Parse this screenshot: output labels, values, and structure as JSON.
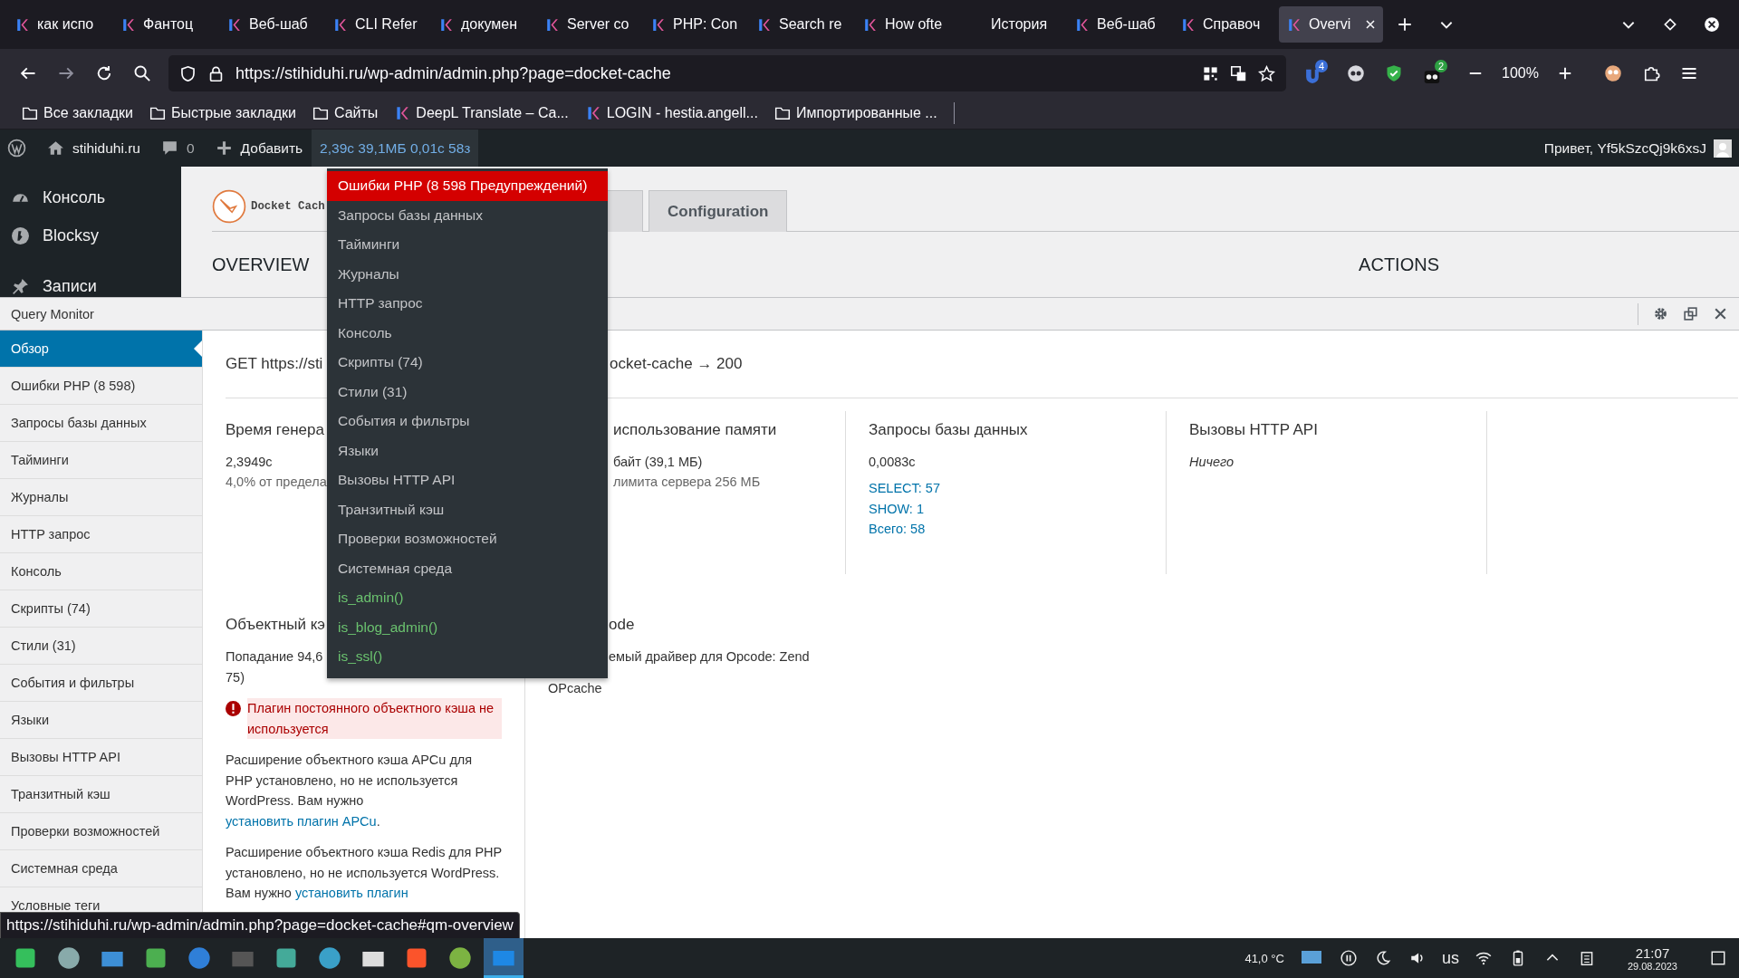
{
  "browser": {
    "tabs": [
      {
        "title": "как испо",
        "has_icon": true,
        "selected": false
      },
      {
        "title": "Фантоц",
        "has_icon": true,
        "selected": false
      },
      {
        "title": "Веб-шаб",
        "has_icon": true,
        "selected": false
      },
      {
        "title": "CLI Refer",
        "has_icon": true,
        "selected": false
      },
      {
        "title": "докумен",
        "has_icon": true,
        "selected": false
      },
      {
        "title": "Server co",
        "has_icon": true,
        "selected": false
      },
      {
        "title": "PHP: Con",
        "has_icon": true,
        "selected": false
      },
      {
        "title": "Search re",
        "has_icon": true,
        "selected": false
      },
      {
        "title": "How ofte",
        "has_icon": true,
        "selected": false
      },
      {
        "title": "История",
        "has_icon": false,
        "selected": false
      },
      {
        "title": "Веб-шаб",
        "has_icon": true,
        "selected": false
      },
      {
        "title": "Справоч",
        "has_icon": true,
        "selected": false
      },
      {
        "title": "Overvi",
        "has_icon": true,
        "selected": true
      }
    ],
    "url": "https://stihiduhi.ru/wp-admin/admin.php?page=docket-cache",
    "extension_badges": [
      "4",
      "2"
    ],
    "zoom": "100%",
    "bookmarks": [
      {
        "label": "Все закладки",
        "kind": "folder"
      },
      {
        "label": "Быстрые закладки",
        "kind": "folder"
      },
      {
        "label": "Сайты",
        "kind": "folder"
      },
      {
        "label": "DeepL Translate – Ca...",
        "kind": "site"
      },
      {
        "label": "LOGIN - hestia.angell...",
        "kind": "site"
      },
      {
        "label": "Импортированные ...",
        "kind": "folder"
      }
    ]
  },
  "admin_bar": {
    "site": "stihiduhi.ru",
    "comments": "0",
    "new": "Добавить",
    "qm_stats": "2,39с 39,1МБ 0,01с 58з",
    "greeting": "Привет, Yf5kSzcQj9k6xsJ"
  },
  "wp_menu": [
    "Консоль",
    "Blocksy",
    "Записи"
  ],
  "plugin": {
    "name": "Docket Cach",
    "tabs": [
      {
        "label": "Configuration",
        "selected": false
      }
    ],
    "sections": [
      "OVERVIEW",
      "ACTIONS"
    ]
  },
  "query_monitor": {
    "title": "Query Monitor",
    "nav": [
      {
        "label": "Обзор",
        "selected": true
      },
      {
        "label": "Ошибки PHP (8 598)",
        "selected": false
      },
      {
        "label": "Запросы базы данных",
        "selected": false
      },
      {
        "label": "Тайминги",
        "selected": false
      },
      {
        "label": "Журналы",
        "selected": false
      },
      {
        "label": "HTTP запрос",
        "selected": false
      },
      {
        "label": "Консоль",
        "selected": false
      },
      {
        "label": "Скрипты (74)",
        "selected": false
      },
      {
        "label": "Стили (31)",
        "selected": false
      },
      {
        "label": "События и фильтры",
        "selected": false
      },
      {
        "label": "Языки",
        "selected": false
      },
      {
        "label": "Вызовы HTTP API",
        "selected": false
      },
      {
        "label": "Транзитный кэш",
        "selected": false
      },
      {
        "label": "Проверки возможностей",
        "selected": false
      },
      {
        "label": "Системная среда",
        "selected": false
      },
      {
        "label": "Условные теги",
        "selected": false
      }
    ],
    "request": [
      "GET https://sti",
      "ocket-cache → 200"
    ],
    "overview": [
      {
        "title": "Время генера",
        "value": "2,3949с",
        "note": "4,0% от предела"
      },
      {
        "title": "использование памяти",
        "value": "байт (39,1 МБ)",
        "note": "лимита сервера 256 МБ"
      },
      {
        "title": "Запросы базы данных",
        "value": "0,0083с",
        "links": [
          "SELECT: 57",
          "SHOW: 1",
          "Всего: 58"
        ]
      },
      {
        "title": "Вызовы HTTP API",
        "empty": "Ничего"
      }
    ],
    "object_cache": {
      "title": "Объектный кэ",
      "hit": [
        "Попадание 94,6",
        "75)"
      ],
      "warning": "Плагин постоянного объектного кэша не используется",
      "paragraphs": [
        {
          "text": "Расширение объектного кэша APCu для PHP установлено, но не используется WordPress. Вам нужно ",
          "link": "установить плагин APCu",
          "after": "."
        },
        {
          "text": "Расширение объектного кэша Redis для PHP установлено, но не используется WordPress. Вам нужно ",
          "link": "установить плагин"
        }
      ]
    },
    "opcode": {
      "title": "ode",
      "driver": "емый драйвер для Opcode: Zend",
      "name": "OPcache"
    }
  },
  "dropdown": [
    {
      "label": "Ошибки PHP (8 598 Предупреждений)",
      "kind": "error"
    },
    {
      "label": "Запросы базы данных",
      "kind": "item"
    },
    {
      "label": "Тайминги",
      "kind": "item"
    },
    {
      "label": "Журналы",
      "kind": "item"
    },
    {
      "label": "HTTP запрос",
      "kind": "item"
    },
    {
      "label": "Консоль",
      "kind": "item"
    },
    {
      "label": "Скрипты (74)",
      "kind": "item"
    },
    {
      "label": "Стили (31)",
      "kind": "item"
    },
    {
      "label": "События и фильтры",
      "kind": "item"
    },
    {
      "label": "Языки",
      "kind": "item"
    },
    {
      "label": "Вызовы HTTP API",
      "kind": "item"
    },
    {
      "label": "Транзитный кэш",
      "kind": "item"
    },
    {
      "label": "Проверки возможностей",
      "kind": "item"
    },
    {
      "label": "Системная среда",
      "kind": "item"
    },
    {
      "label": "is_admin()",
      "kind": "condition"
    },
    {
      "label": "is_blog_admin()",
      "kind": "condition"
    },
    {
      "label": "is_ssl()",
      "kind": "condition"
    }
  ],
  "status_url": "https://stihiduhi.ru/wp-admin/admin.php?page=docket-cache#qm-overview",
  "taskbar": {
    "apps": [
      {
        "selected": false
      },
      {
        "selected": false
      },
      {
        "selected": false
      },
      {
        "selected": false
      },
      {
        "selected": false
      },
      {
        "selected": false
      },
      {
        "selected": false
      },
      {
        "selected": false
      },
      {
        "selected": false
      },
      {
        "selected": false
      },
      {
        "selected": false
      },
      {
        "selected": true
      }
    ],
    "temperature": "41,0 °C",
    "layout": "us",
    "time": "21:07",
    "date": "29.08.2023"
  }
}
